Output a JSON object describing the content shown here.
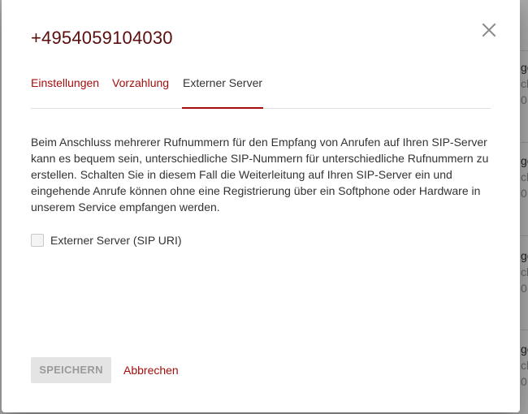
{
  "dialog": {
    "title": "+4954059104030",
    "tabs": [
      {
        "label": "Einstellungen",
        "active": false
      },
      {
        "label": "Vorzahlung",
        "active": false
      },
      {
        "label": "Externer Server",
        "active": true
      }
    ],
    "description": "Beim Anschluss mehrerer Rufnummern für den Empfang von Anrufen auf Ihren SIP-Server kann es bequem sein, unterschiedliche SIP-Nummern für unterschiedliche Rufnummern zu erstellen. Schalten Sie in diesem Fall die Weiterleitung auf Ihren SIP-Server ein und eingehende Anrufe können ohne eine Registrierung über ein Softphone oder Hardware in unserem Service empfangen werden.",
    "checkbox": {
      "label": "Externer Server (SIP URI)",
      "checked": false
    },
    "save_label": "SPEICHERN",
    "cancel_label": "Abbrechen"
  },
  "background": {
    "fragments": [
      {
        "l1": "ge",
        "l2": "ch",
        "l3": "0"
      },
      {
        "l1": "ge",
        "l2": "ch",
        "l3": "0"
      },
      {
        "l1": "ge",
        "l2": "ch",
        "l3": "0"
      },
      {
        "l1": "ge",
        "l2": "ch",
        "l3": "0"
      }
    ]
  },
  "colors": {
    "accent": "#a30d0d",
    "title": "#5a0d0d",
    "text": "#333333",
    "disabled_button_bg": "#e4e4e4",
    "disabled_button_text": "#9a9a9a"
  }
}
